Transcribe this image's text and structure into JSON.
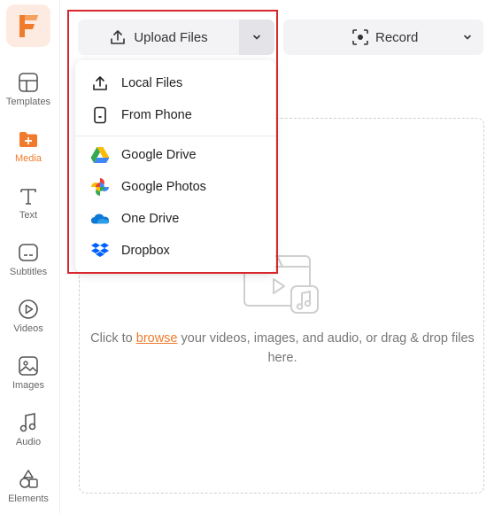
{
  "sidebar": {
    "items": [
      {
        "label": "Templates",
        "icon": "templates-icon"
      },
      {
        "label": "Media",
        "icon": "media-icon"
      },
      {
        "label": "Text",
        "icon": "text-icon"
      },
      {
        "label": "Subtitles",
        "icon": "subtitles-icon"
      },
      {
        "label": "Videos",
        "icon": "videos-icon"
      },
      {
        "label": "Images",
        "icon": "images-icon"
      },
      {
        "label": "Audio",
        "icon": "audio-icon"
      },
      {
        "label": "Elements",
        "icon": "elements-icon"
      }
    ],
    "active_color": "#f07b2c"
  },
  "toolbar": {
    "upload_label": "Upload Files",
    "record_label": "Record"
  },
  "dropdown": {
    "items": [
      {
        "label": "Local Files",
        "icon": "upload-icon"
      },
      {
        "label": "From Phone",
        "icon": "phone-icon"
      },
      {
        "label": "Google Drive",
        "icon": "google-drive-icon"
      },
      {
        "label": "Google Photos",
        "icon": "google-photos-icon"
      },
      {
        "label": "One Drive",
        "icon": "onedrive-icon"
      },
      {
        "label": "Dropbox",
        "icon": "dropbox-icon"
      }
    ]
  },
  "dropzone": {
    "text_before": "Click to ",
    "link": "browse",
    "text_after": " your videos, images, and audio, or drag & drop files here."
  },
  "colors": {
    "accent": "#f07b2c",
    "highlight": "#d9262c"
  }
}
